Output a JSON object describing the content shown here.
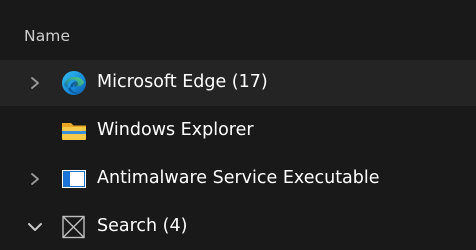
{
  "header": {
    "name_label": "Name"
  },
  "rows": [
    {
      "label": "Microsoft Edge (17)",
      "icon": "edge-icon",
      "state": "collapsed",
      "selected": true
    },
    {
      "label": "Windows Explorer",
      "icon": "folder-icon",
      "state": "none",
      "selected": false
    },
    {
      "label": "Antimalware Service Executable",
      "icon": "app-window-icon",
      "state": "collapsed",
      "selected": false
    },
    {
      "label": "Search (4)",
      "icon": "search-app-icon",
      "state": "expanded",
      "selected": false
    }
  ],
  "colors": {
    "background": "#191919",
    "selected_row": "#242424",
    "header_text": "#cfcfcf",
    "text": "#ffffff",
    "chevron": "#9a9a9a"
  }
}
